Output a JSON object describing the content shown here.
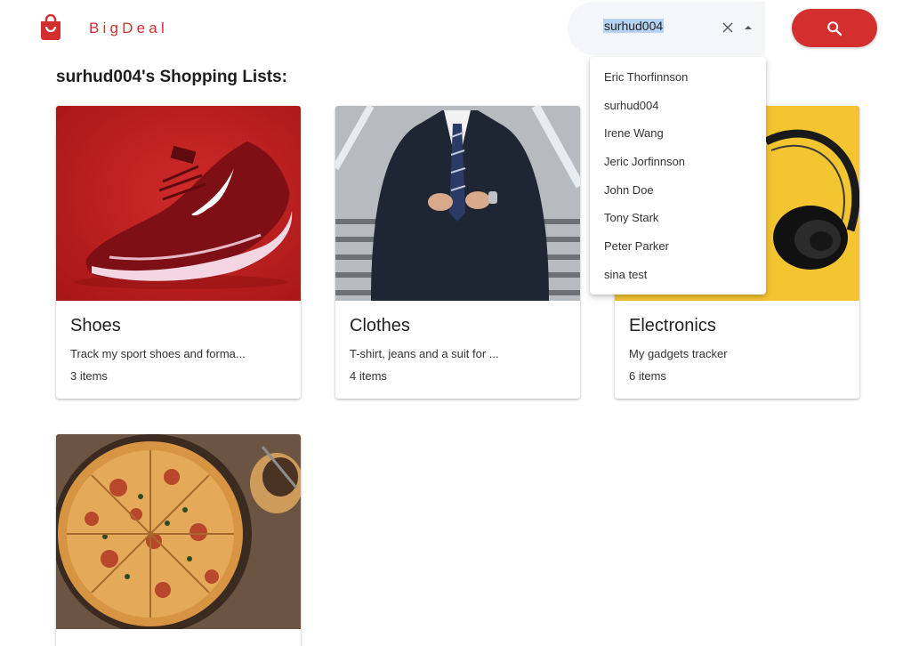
{
  "brand": {
    "name": "BigDeal",
    "accent": "#d32f2f"
  },
  "search": {
    "value": "surhud004",
    "button_icon": "search-icon"
  },
  "dropdown": {
    "options": [
      "Eric Thorfinnson",
      "surhud004",
      "Irene Wang",
      "Jeric Jorfinnson",
      "John Doe",
      "Tony Stark",
      "Peter Parker",
      "sina test"
    ]
  },
  "page": {
    "title": "surhud004's Shopping Lists:"
  },
  "lists": [
    {
      "title": "Shoes",
      "description": "Track my sport shoes and forma...",
      "count": "3 items",
      "image": "red-sneaker"
    },
    {
      "title": "Clothes",
      "description": "T-shirt, jeans and a suit for ...",
      "count": "4 items",
      "image": "suit-man"
    },
    {
      "title": "Electronics",
      "description": "My gadgets tracker",
      "count": "6 items",
      "image": "headphones"
    },
    {
      "title": "",
      "description": "",
      "count": "",
      "image": "pizza"
    }
  ]
}
